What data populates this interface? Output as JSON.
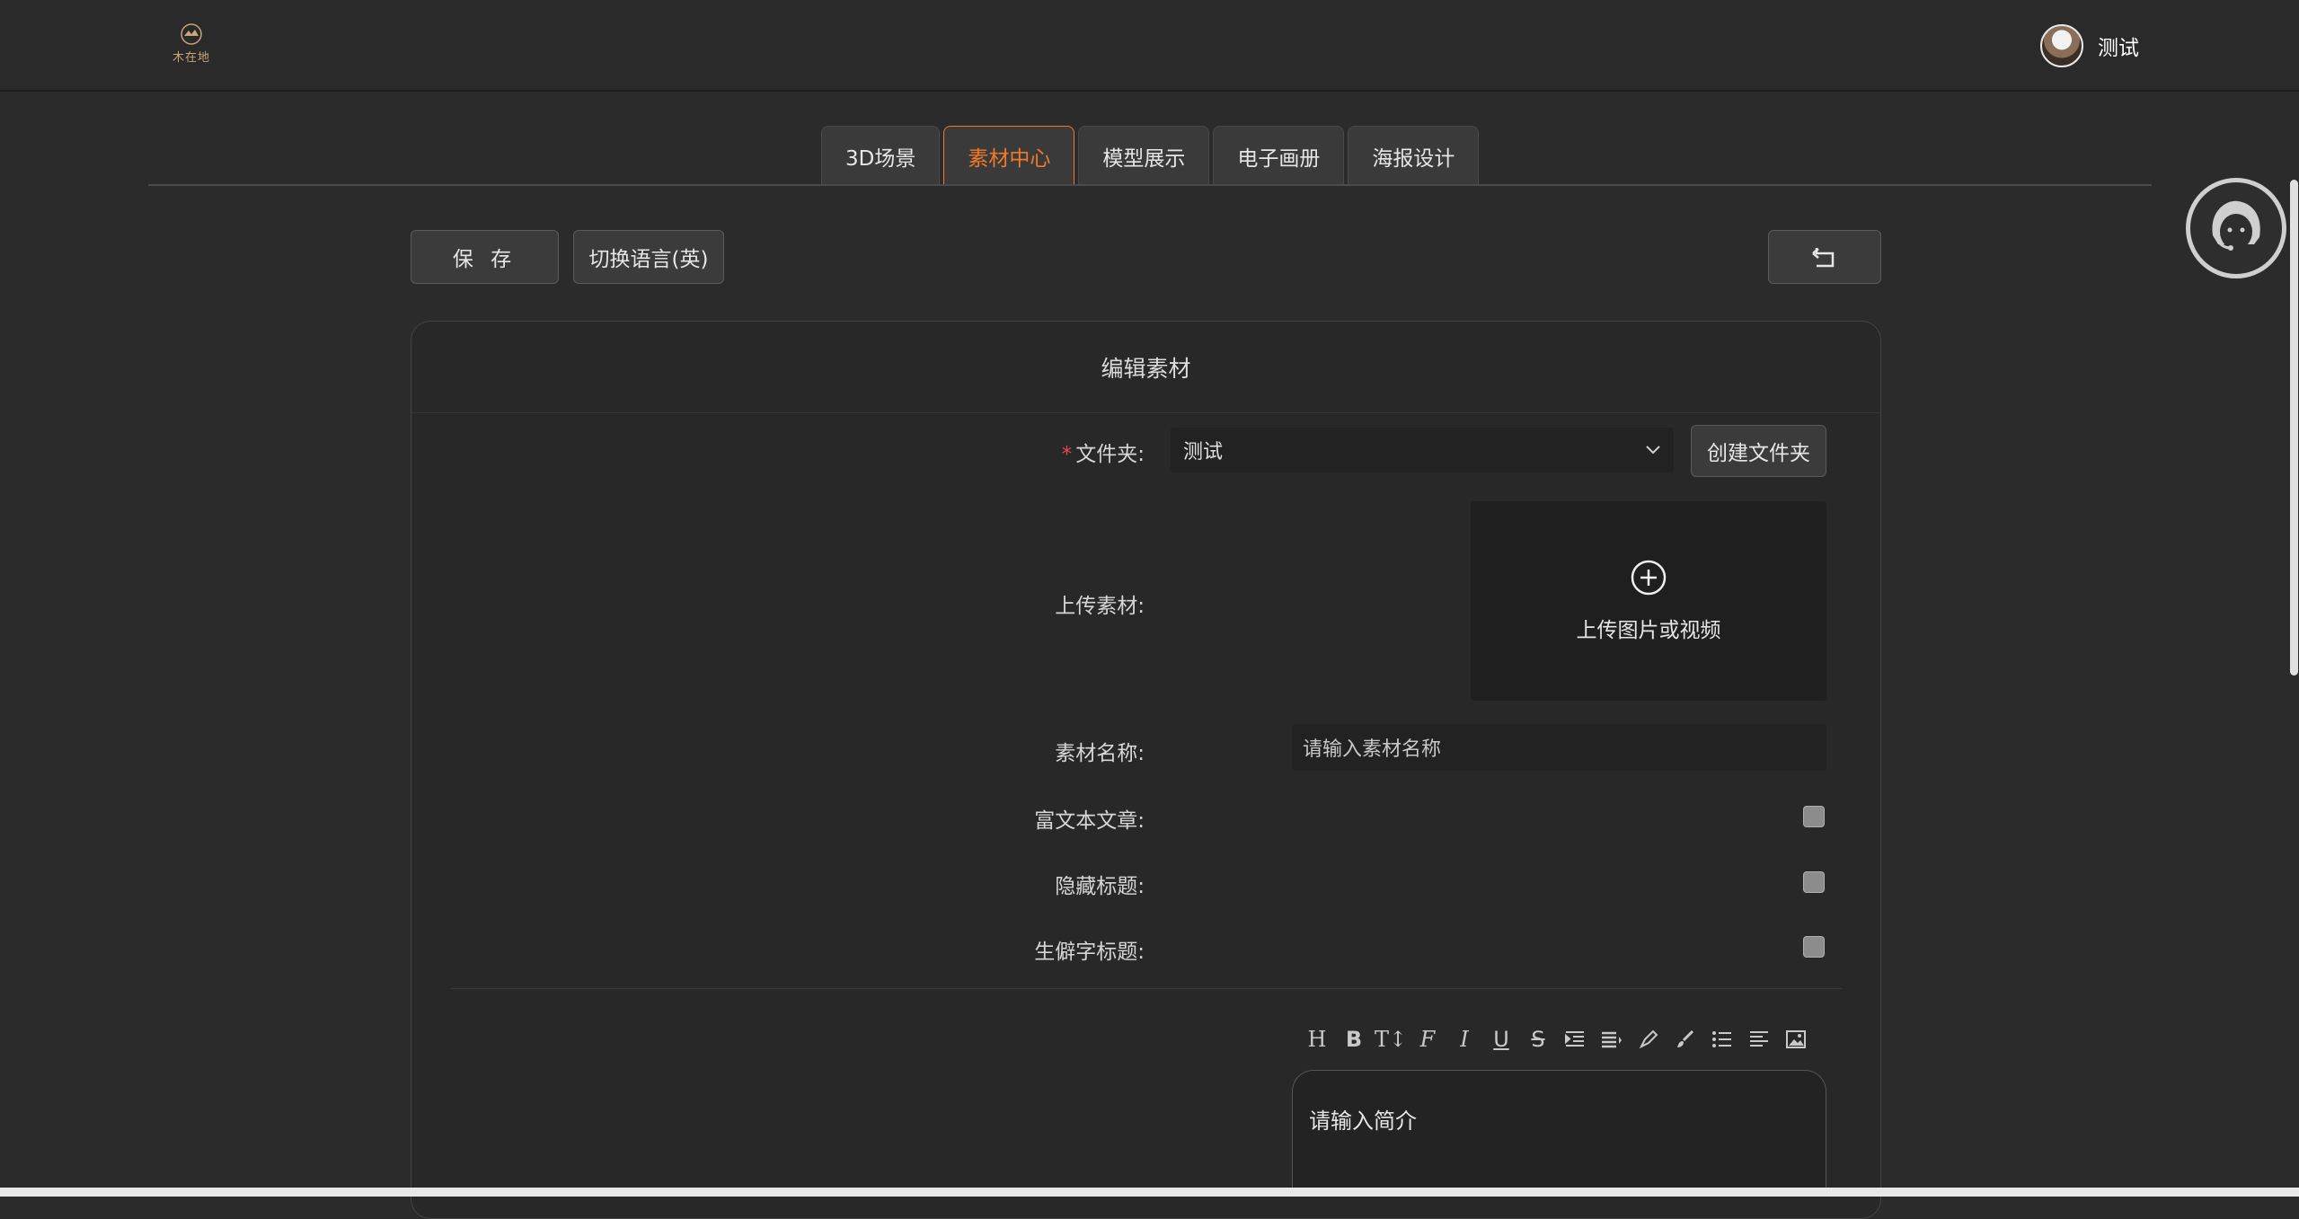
{
  "header": {
    "logo_text": "木在地",
    "user_name": "测试"
  },
  "tabs": [
    {
      "label": "3D场景",
      "active": false
    },
    {
      "label": "素材中心",
      "active": true
    },
    {
      "label": "模型展示",
      "active": false
    },
    {
      "label": "电子画册",
      "active": false
    },
    {
      "label": "海报设计",
      "active": false
    }
  ],
  "toolbar": {
    "save_label": "保 存",
    "language_label": "切换语言(英)",
    "back_icon": "return-icon"
  },
  "form": {
    "title": "编辑素材",
    "folder": {
      "label": "文件夹:",
      "required_mark": "*",
      "selected": "测试",
      "create_label": "创建文件夹"
    },
    "upload": {
      "label": "上传素材:",
      "text": "上传图片或视频"
    },
    "name": {
      "label": "素材名称:",
      "placeholder": "请输入素材名称"
    },
    "rich_text": {
      "label": "富文本文章:",
      "checked": false
    },
    "hide_title": {
      "label": "隐藏标题:",
      "checked": false
    },
    "rare_char_title": {
      "label": "生僻字标题:",
      "checked": false
    },
    "editor": {
      "tools": [
        "H",
        "B",
        "T↕",
        "F",
        "I",
        "U",
        "S",
        "indent",
        "align",
        "highlight",
        "brush",
        "list",
        "justify",
        "image"
      ],
      "placeholder": "请输入简介"
    }
  },
  "colors": {
    "accent": "#f07a2a",
    "background": "#2b2b2b",
    "required": "#e5484d"
  }
}
